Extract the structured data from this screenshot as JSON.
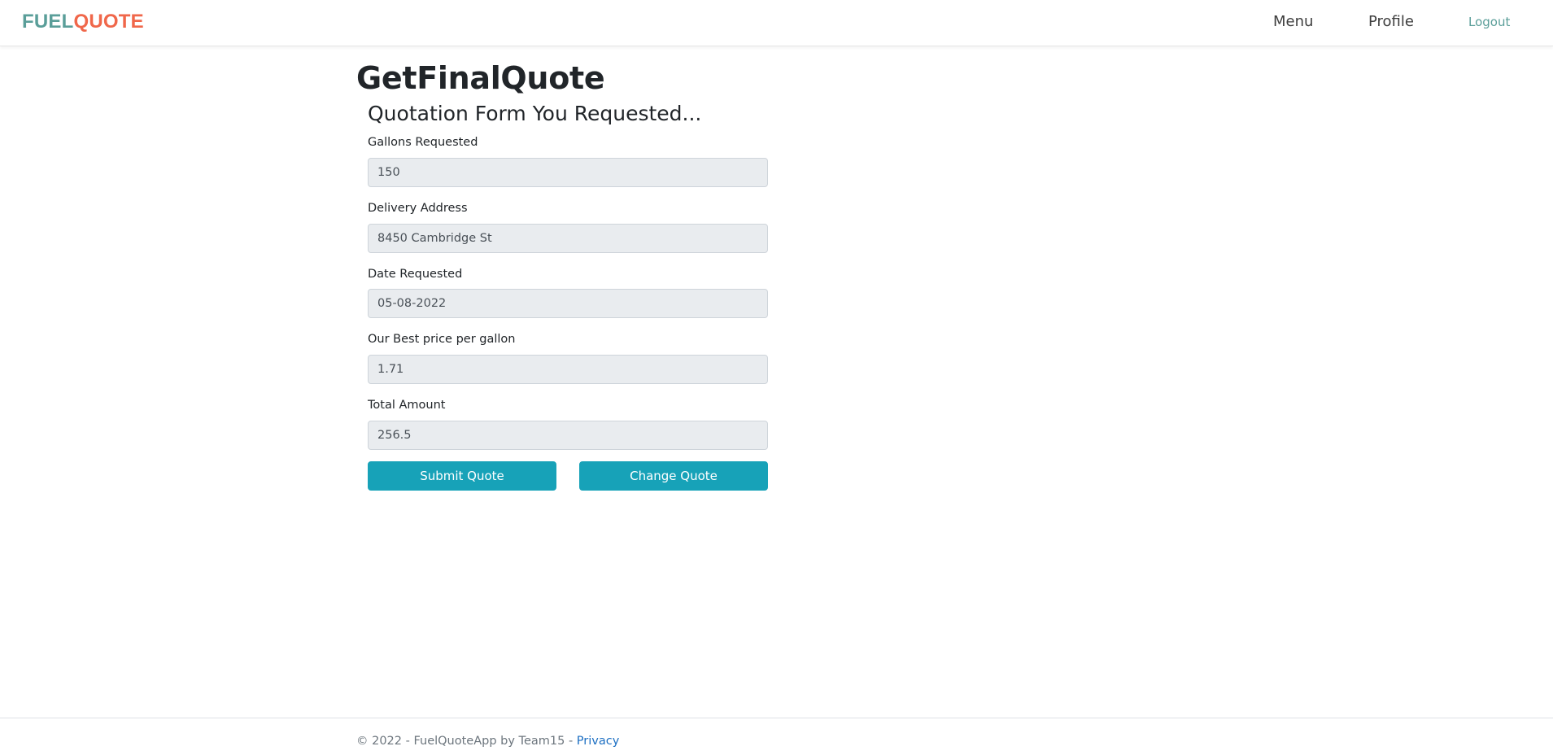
{
  "navbar": {
    "brand_part1": "FUEL",
    "brand_part2": "QUOTE",
    "links": {
      "menu": "Menu",
      "profile": "Profile",
      "logout": "Logout"
    }
  },
  "page": {
    "title": "GetFinalQuote",
    "form_title": "Quotation Form You Requested..."
  },
  "form": {
    "gallons": {
      "label": "Gallons Requested",
      "value": "150"
    },
    "address": {
      "label": "Delivery Address",
      "value": "8450 Cambridge St"
    },
    "date": {
      "label": "Date Requested",
      "value": "05-08-2022"
    },
    "price": {
      "label": "Our Best price per gallon",
      "value": "1.71"
    },
    "total": {
      "label": "Total Amount",
      "value": "256.5"
    },
    "submit_label": "Submit Quote",
    "change_label": "Change Quote"
  },
  "footer": {
    "text": "© 2022 - FuelQuoteApp by Team15 - ",
    "privacy_label": "Privacy"
  },
  "colors": {
    "brand_fuel": "#5a9e99",
    "brand_quote": "#f0674a",
    "button": "#17a2b8",
    "input_bg": "#e9ecef",
    "link": "#1b6ec2"
  }
}
